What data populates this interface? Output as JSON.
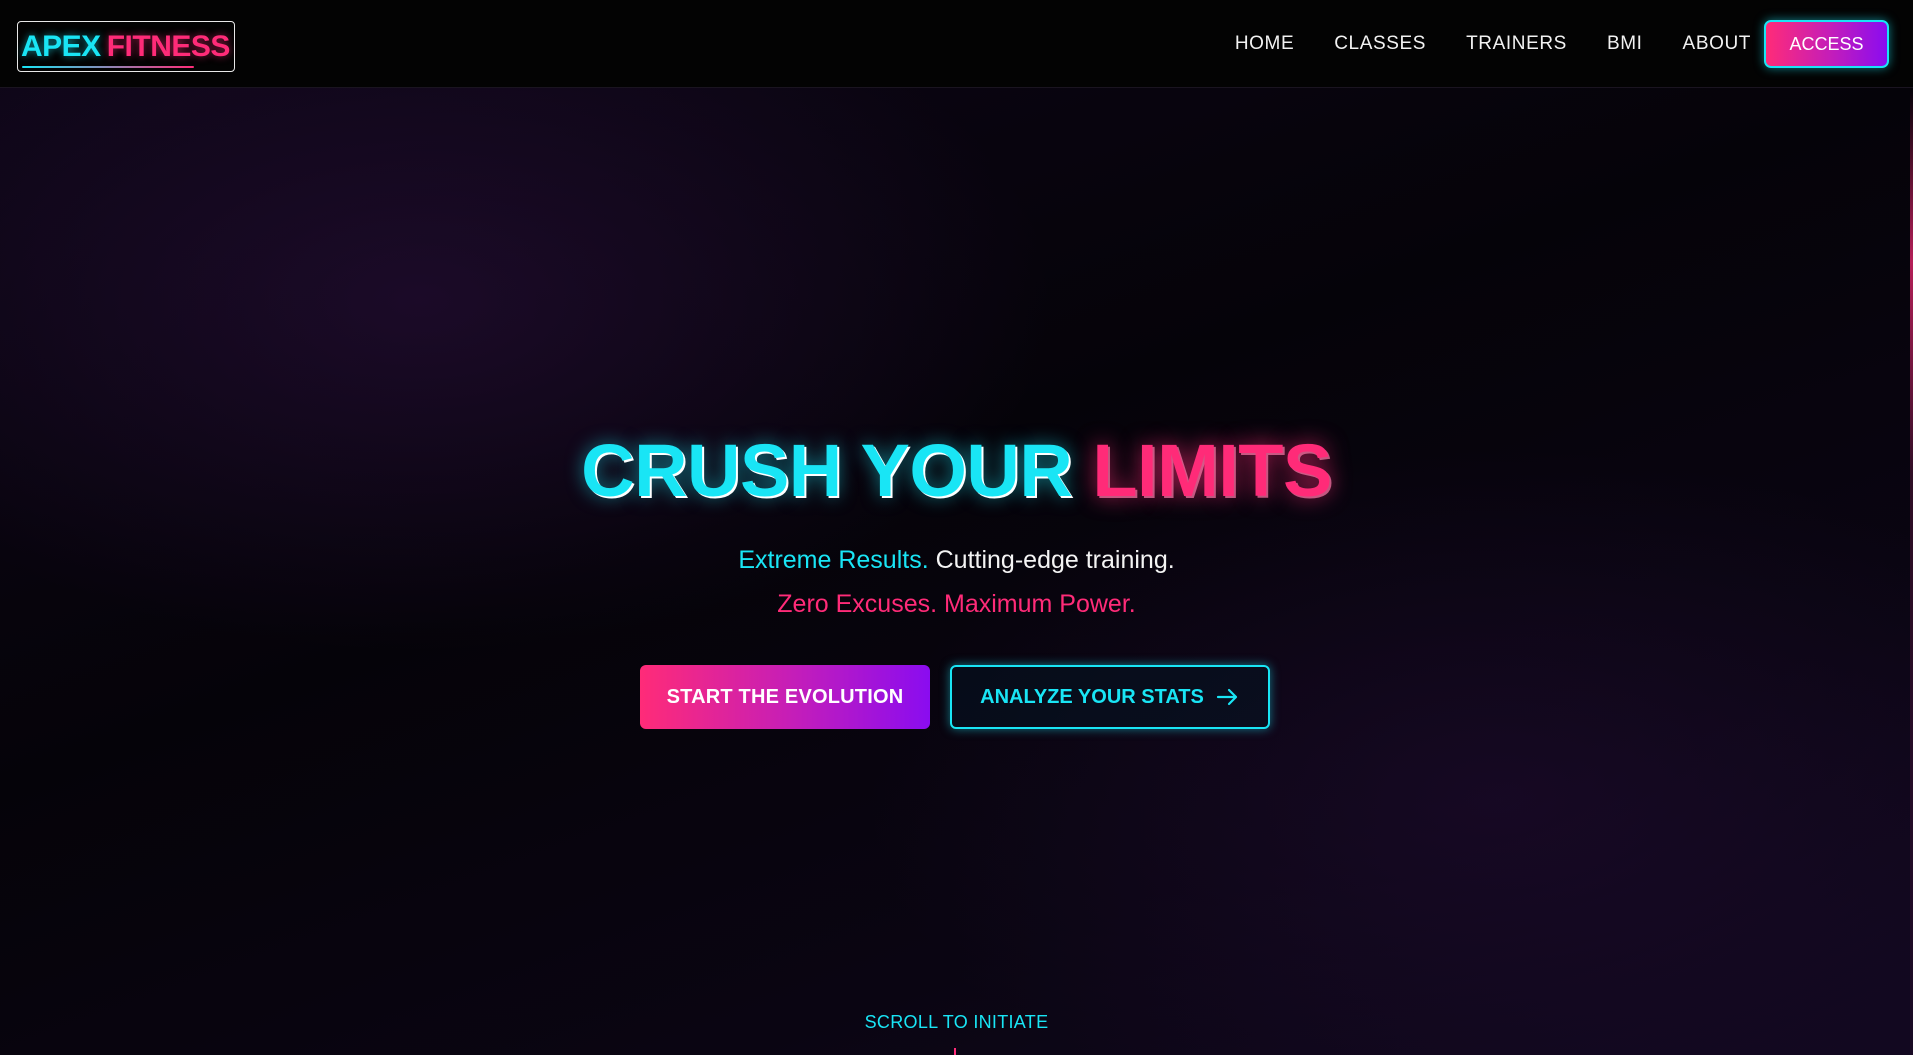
{
  "brand": {
    "part1": "APEX",
    "part2": "FITNESS"
  },
  "nav": {
    "items": [
      {
        "label": "HOME"
      },
      {
        "label": "CLASSES"
      },
      {
        "label": "TRAINERS"
      },
      {
        "label": "BMI"
      },
      {
        "label": "ABOUT"
      }
    ],
    "access_label": "ACCESS"
  },
  "hero": {
    "title_part1": "CRUSH YOUR",
    "title_part2": "LIMITS",
    "line1_highlight": "Extreme Results.",
    "line1_rest": "Cutting-edge training.",
    "line2": "Zero Excuses. Maximum Power.",
    "primary_cta": "START THE EVOLUTION",
    "secondary_cta": "ANALYZE YOUR STATS",
    "scroll_hint": "SCROLL TO INITIATE"
  },
  "colors": {
    "accent_cyan": "#19e5f5",
    "accent_pink": "#ff2b78",
    "accent_purple": "#8a0cf0",
    "background": "#050308"
  },
  "icons": {
    "secondary_cta_icon": "arrow-right-icon"
  }
}
